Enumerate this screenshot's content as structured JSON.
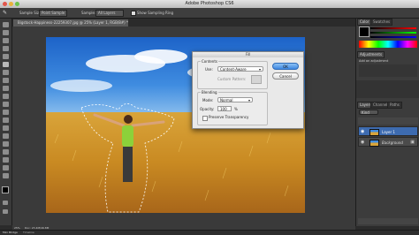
{
  "app": {
    "title": "Adobe Photoshop CS6"
  },
  "options": {
    "sample_size_label": "Sample Size:",
    "sample_size_value": "Point Sample",
    "sample_label": "Sample:",
    "sample_value": "All Layers",
    "show_ring_label": "Show Sampling Ring"
  },
  "document": {
    "tab": "Bigstock-Happiness-22259307.jpg @ 25% (Layer 1, RGB/8#) *"
  },
  "fill_dialog": {
    "title": "Fill",
    "contents_label": "Contents",
    "use_label": "Use:",
    "use_value": "Content-Aware",
    "custom_pattern_label": "Custom Pattern:",
    "blending_label": "Blending",
    "mode_label": "Mode:",
    "mode_value": "Normal",
    "opacity_label": "Opacity:",
    "opacity_value": "100",
    "opacity_unit": "%",
    "preserve_label": "Preserve Transparency",
    "ok_label": "OK",
    "cancel_label": "Cancel"
  },
  "panels": {
    "color_tab": "Color",
    "swatches_tab": "Swatches",
    "adjustments_tab": "Adjustments",
    "add_adjustment": "Add an adjustment",
    "layers_tab": "Layers",
    "channels_tab": "Channels",
    "paths_tab": "Paths",
    "kind_label": "Kind",
    "layers": [
      {
        "name": "Layer 1"
      },
      {
        "name": "Background"
      }
    ]
  },
  "status": {
    "zoom": "25%",
    "doc_info": "Doc: 23.4M/46.8M"
  },
  "bottom_tabs": {
    "mini_bridge": "Mini Bridge",
    "timeline": "Timeline"
  },
  "colors": {
    "accent": "#3d6bb0",
    "ok_button": "#5b9be8"
  }
}
